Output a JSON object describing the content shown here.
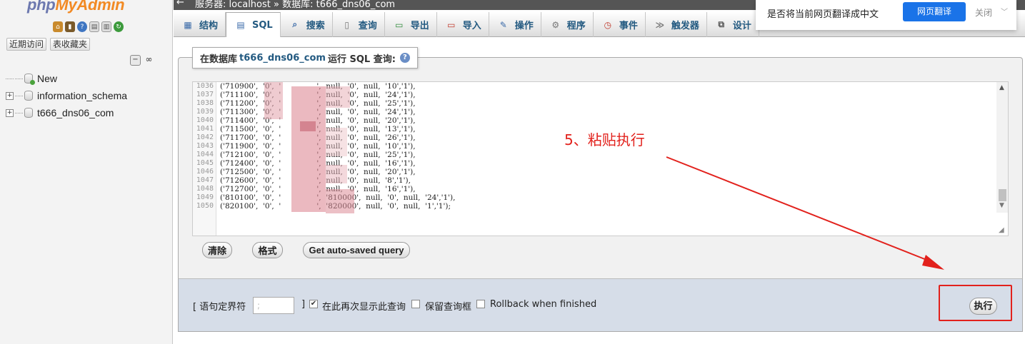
{
  "logo": {
    "part1": "php",
    "part2": "MyAdmin"
  },
  "nav": {
    "recent_label": "近期访问",
    "favorites_label": "表收藏夹",
    "tree": [
      {
        "label": "New",
        "expandable": false
      },
      {
        "label": "information_schema",
        "expandable": true
      },
      {
        "label": "t666_dns06_com",
        "expandable": true
      }
    ]
  },
  "breadcrumb": {
    "text": "服务器: localhost » 数据库: t666_dns06_com"
  },
  "tabs": [
    {
      "label": "结构",
      "icon": "structure-icon"
    },
    {
      "label": "SQL",
      "icon": "sql-icon",
      "active": true
    },
    {
      "label": "搜索",
      "icon": "search-icon"
    },
    {
      "label": "查询",
      "icon": "query-icon"
    },
    {
      "label": "导出",
      "icon": "export-icon"
    },
    {
      "label": "导入",
      "icon": "import-icon"
    },
    {
      "label": "操作",
      "icon": "wrench-icon"
    },
    {
      "label": "程序",
      "icon": "routines-icon"
    },
    {
      "label": "事件",
      "icon": "clock-icon"
    },
    {
      "label": "触发器",
      "icon": "triggers-icon"
    },
    {
      "label": "设计",
      "icon": "designer-icon"
    }
  ],
  "translate_popup": {
    "question": "是否将当前网页翻译成中文",
    "translate_button": "网页翻译",
    "close": "关闭",
    "accent": "#1a73e8"
  },
  "sql_panel": {
    "legend_prefix": "在数据库",
    "database": "t666_dns06_com",
    "legend_suffix": "运行 SQL 查询:",
    "lines": [
      {
        "no": "1036",
        "text": "('710900',  '0',  '               ',  null,  '0',  null,  '10','1'),",
        "short": false
      },
      {
        "no": "1037",
        "text": "('711100',  '0',  '               ',  null,  '0',  null,  '24','1'),",
        "short": false
      },
      {
        "no": "1038",
        "text": "('711200',  '0',  '               ',  null,  '0',  null,  '25','1'),",
        "short": false
      },
      {
        "no": "1039",
        "text": "('711300',  '0',  '               ',  null,  '0',  null,  '24','1'),",
        "short": false
      },
      {
        "no": "1040",
        "text": "('711400',  '0',  '               ',  null,  '0',  null,  '20','1'),",
        "short": false
      },
      {
        "no": "1041",
        "text": "('711500',  '0',  '               ',  null,  '0',  null,  '13','1'),",
        "short": false
      },
      {
        "no": "1042",
        "text": "('711700',  '0',  '               ',  null,  '0',  null,  '26','1'),",
        "short": false
      },
      {
        "no": "1043",
        "text": "('711900',  '0',  '               ',  null,  '0',  null,  '10','1'),",
        "short": false
      },
      {
        "no": "1044",
        "text": "('712100',  '0',  '               ',  null,  '0',  null,  '25','1'),",
        "short": false
      },
      {
        "no": "1045",
        "text": "('712400',  '0',  '               ',  null,  '0',  null,  '16','1'),",
        "short": false
      },
      {
        "no": "1046",
        "text": "('712500',  '0',  '               ',  null,  '0',  null,  '20','1'),",
        "short": false
      },
      {
        "no": "1047",
        "text": "('712600',  '0',  '               ',  null,  '0',  null,  '8','1'),",
        "short": false
      },
      {
        "no": "1048",
        "text": "('712700',  '0',  '               ',  null,  '0',  null,  '16','1'),",
        "short": false
      },
      {
        "no": "1049",
        "text": "('810100',  '0',  '               ',  '810000',  null,  '0',  null,  '24','1'),",
        "short": false
      },
      {
        "no": "1050",
        "text": "('820100',  '0',  '               ',  '820000',  null,  '0',  null,  '1','1');",
        "short": false
      }
    ],
    "clear_button": "清除",
    "format_button": "格式",
    "autosaved_button": "Get auto-saved query"
  },
  "options": {
    "delimiter_label_open": "[ 语句定界符",
    "delimiter_value": ";",
    "delimiter_label_close": "]",
    "show_again_label": "在此再次显示此查询",
    "show_again_checked": true,
    "retain_box_label": "保留查询框",
    "retain_box_checked": false,
    "rollback_label": "Rollback when finished",
    "rollback_checked": false,
    "go_button": "执行"
  },
  "annotation": {
    "text": "5、粘贴执行",
    "color": "#e2211c"
  }
}
